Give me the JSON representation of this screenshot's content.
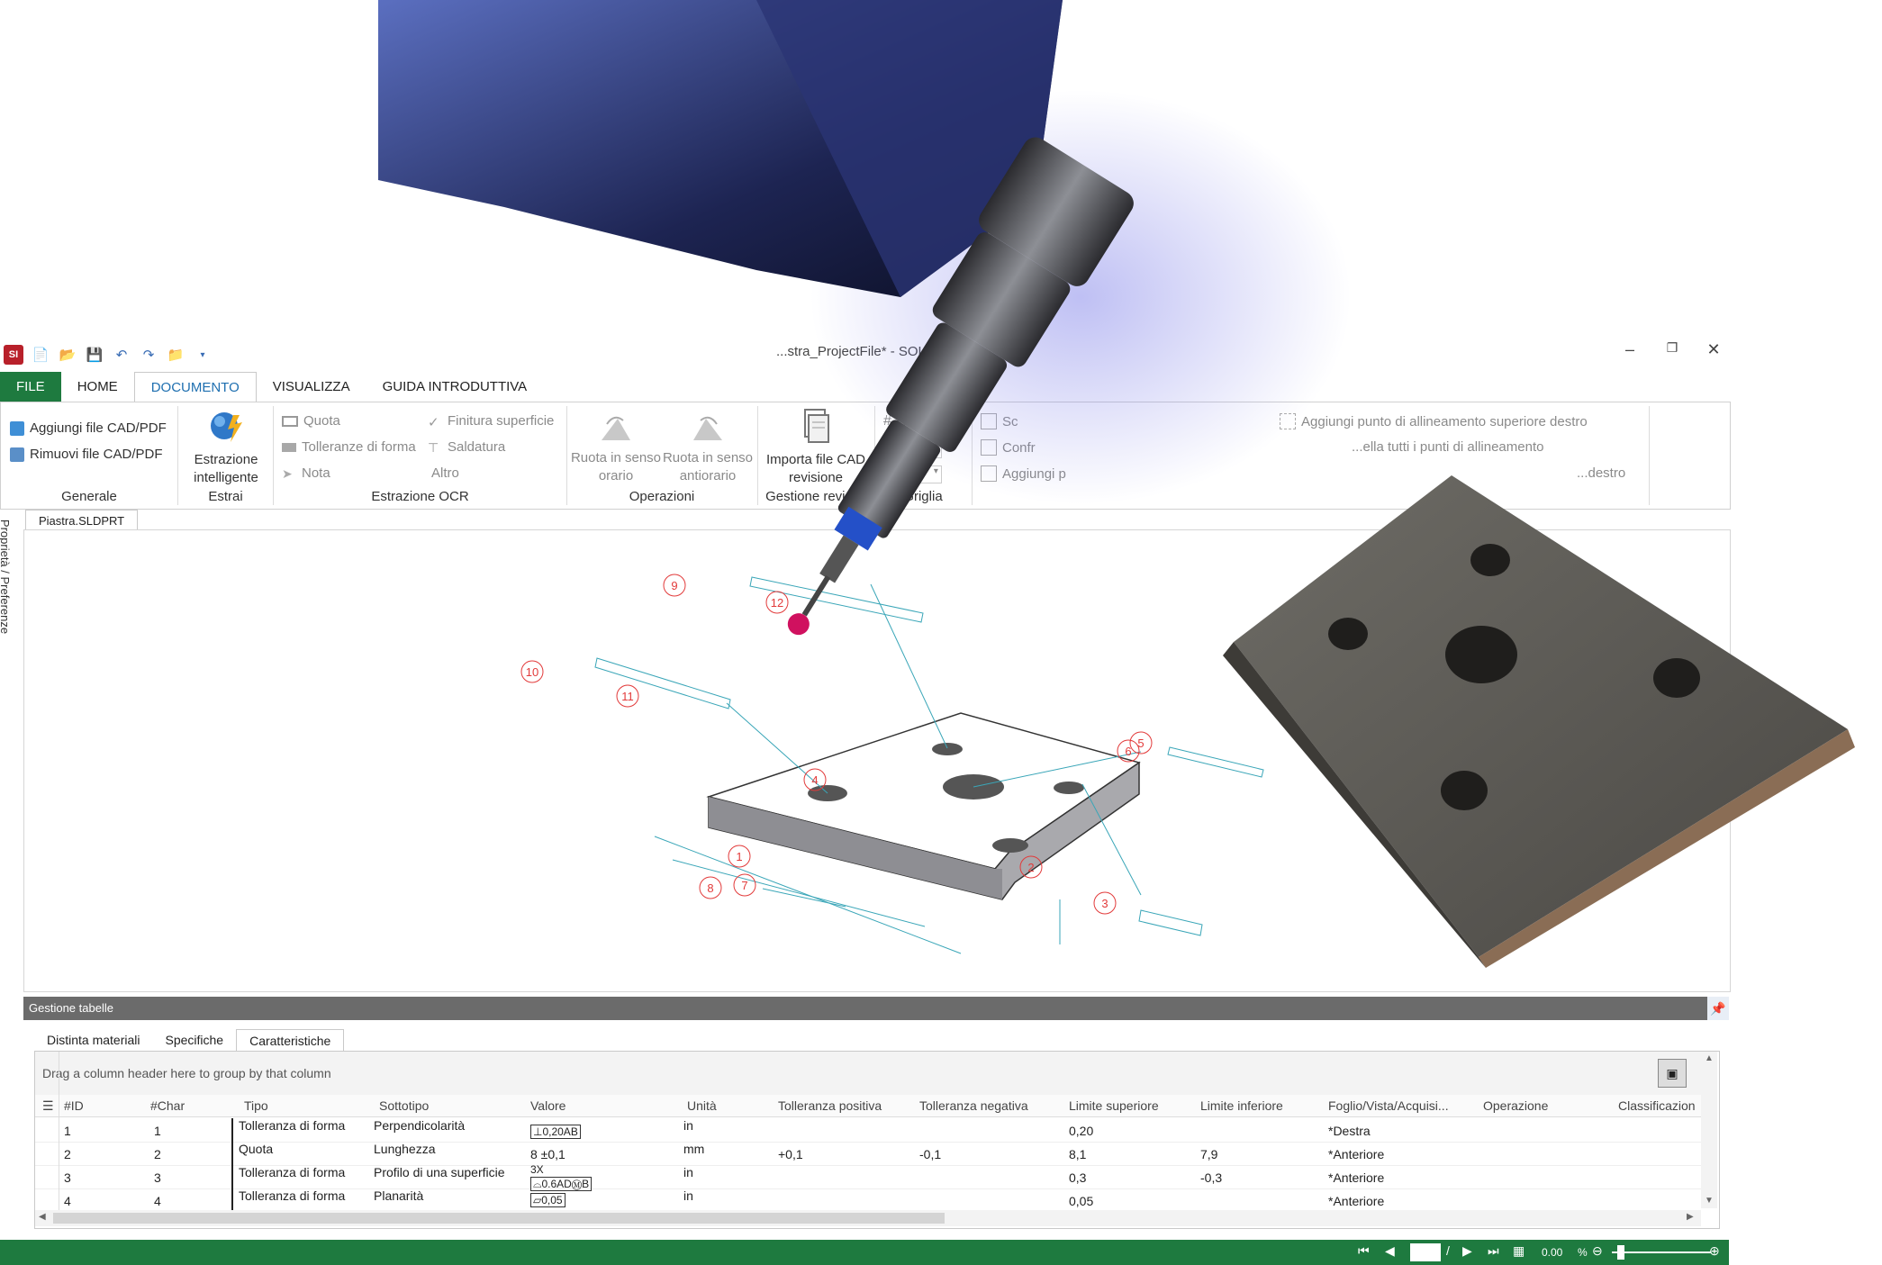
{
  "window": {
    "title": "...stra_ProjectFile* - SOLID..."
  },
  "ribbon": {
    "tabs": [
      "FILE",
      "HOME",
      "DOCUMENTO",
      "VISUALIZZA",
      "GUIDA INTRODUTTIVA"
    ],
    "generale": {
      "add": "Aggiungi file CAD/PDF",
      "remove": "Rimuovi file CAD/PDF",
      "label": "Generale"
    },
    "estrai": {
      "smart1": "Estrazione",
      "smart2": "intelligente",
      "label": "Estrai"
    },
    "ocr": {
      "quota": "Quota",
      "tolleranze": "Tolleranze di forma",
      "nota": "Nota",
      "finitura": "Finitura superficie",
      "saldatura": "Saldatura",
      "altro": "Altro",
      "label": "Estrazione OCR"
    },
    "operazioni": {
      "cw1": "Ruota in senso",
      "cw2": "orario",
      "ccw1": "Ruota in senso",
      "ccw2": "antiorario",
      "label": "Operazioni"
    },
    "revisione": {
      "imp1": "Importa file CAD",
      "imp2": "revisione",
      "label": "Gestione revisi..."
    },
    "griglia": {
      "grid": "Griglia",
      "label": "Griglia"
    },
    "cfr": {
      "sc": "Sc",
      "confr": "Confr",
      "aggiungi": "Aggiungi p"
    },
    "align": {
      "add_sup": "Aggiungi punto di allineamento superiore destro",
      "all": "...ella tutti i punti di allineamento",
      "destro": "...destro"
    }
  },
  "side": {
    "label": "Proprietà / Preferenze"
  },
  "document": {
    "tab": "Piastra.SLDPRT"
  },
  "balloons": [
    "9",
    "12",
    "10",
    "11",
    "4",
    "5",
    "6",
    "1",
    "2",
    "3",
    "8",
    "7"
  ],
  "panel": {
    "title": "Gestione tabelle",
    "tabs": [
      "Distinta materiali",
      "Specifiche",
      "Caratteristiche"
    ],
    "hint": "Drag a column header here to group by that column",
    "columns": [
      "#ID",
      "#Char",
      "Tipo",
      "Sottotipo",
      "Valore",
      "Unità",
      "Tolleranza positiva",
      "Tolleranza negativa",
      "Limite superiore",
      "Limite inferiore",
      "Foglio/Vista/Acquisi...",
      "Operazione",
      "Classificazion"
    ],
    "rows": [
      {
        "id": "1",
        "char": "1",
        "tipo": "Tolleranza di forma",
        "sottotipo": "Perpendicolarità",
        "valore": "⊥0,20AB",
        "unita": "in",
        "tolpos": "",
        "tolneg": "",
        "limsup": "0,20",
        "liminf": "",
        "foglio": "*Destra"
      },
      {
        "id": "2",
        "char": "2",
        "tipo": "Quota",
        "sottotipo": "Lunghezza",
        "valore": "8 ±0,1",
        "unita": "mm",
        "tolpos": "+0,1",
        "tolneg": "-0,1",
        "limsup": "8,1",
        "liminf": "7,9",
        "foglio": "*Anteriore"
      },
      {
        "id": "3",
        "char": "3",
        "tipo": "Tolleranza di forma",
        "sottotipo": "Profilo di una superficie",
        "valore": "3X",
        "valore2": "⌓0.6ADⓂB",
        "unita": "in",
        "tolpos": "",
        "tolneg": "",
        "limsup": "0,3",
        "liminf": "-0,3",
        "foglio": "*Anteriore"
      },
      {
        "id": "4",
        "char": "4",
        "tipo": "Tolleranza di forma",
        "sottotipo": "Planarità",
        "valore": "⏥0,05",
        "unita": "in",
        "tolpos": "",
        "tolneg": "",
        "limsup": "0,05",
        "liminf": "",
        "foglio": "*Anteriore"
      }
    ]
  },
  "status": {
    "zoom": "0.00",
    "pct": "%",
    "slash": "/"
  },
  "colors": {
    "accent": "#1e7a3f",
    "active_tab": "#1e6fb0",
    "balloon": "#e23a3a",
    "annotation": "#3aa6b8"
  }
}
